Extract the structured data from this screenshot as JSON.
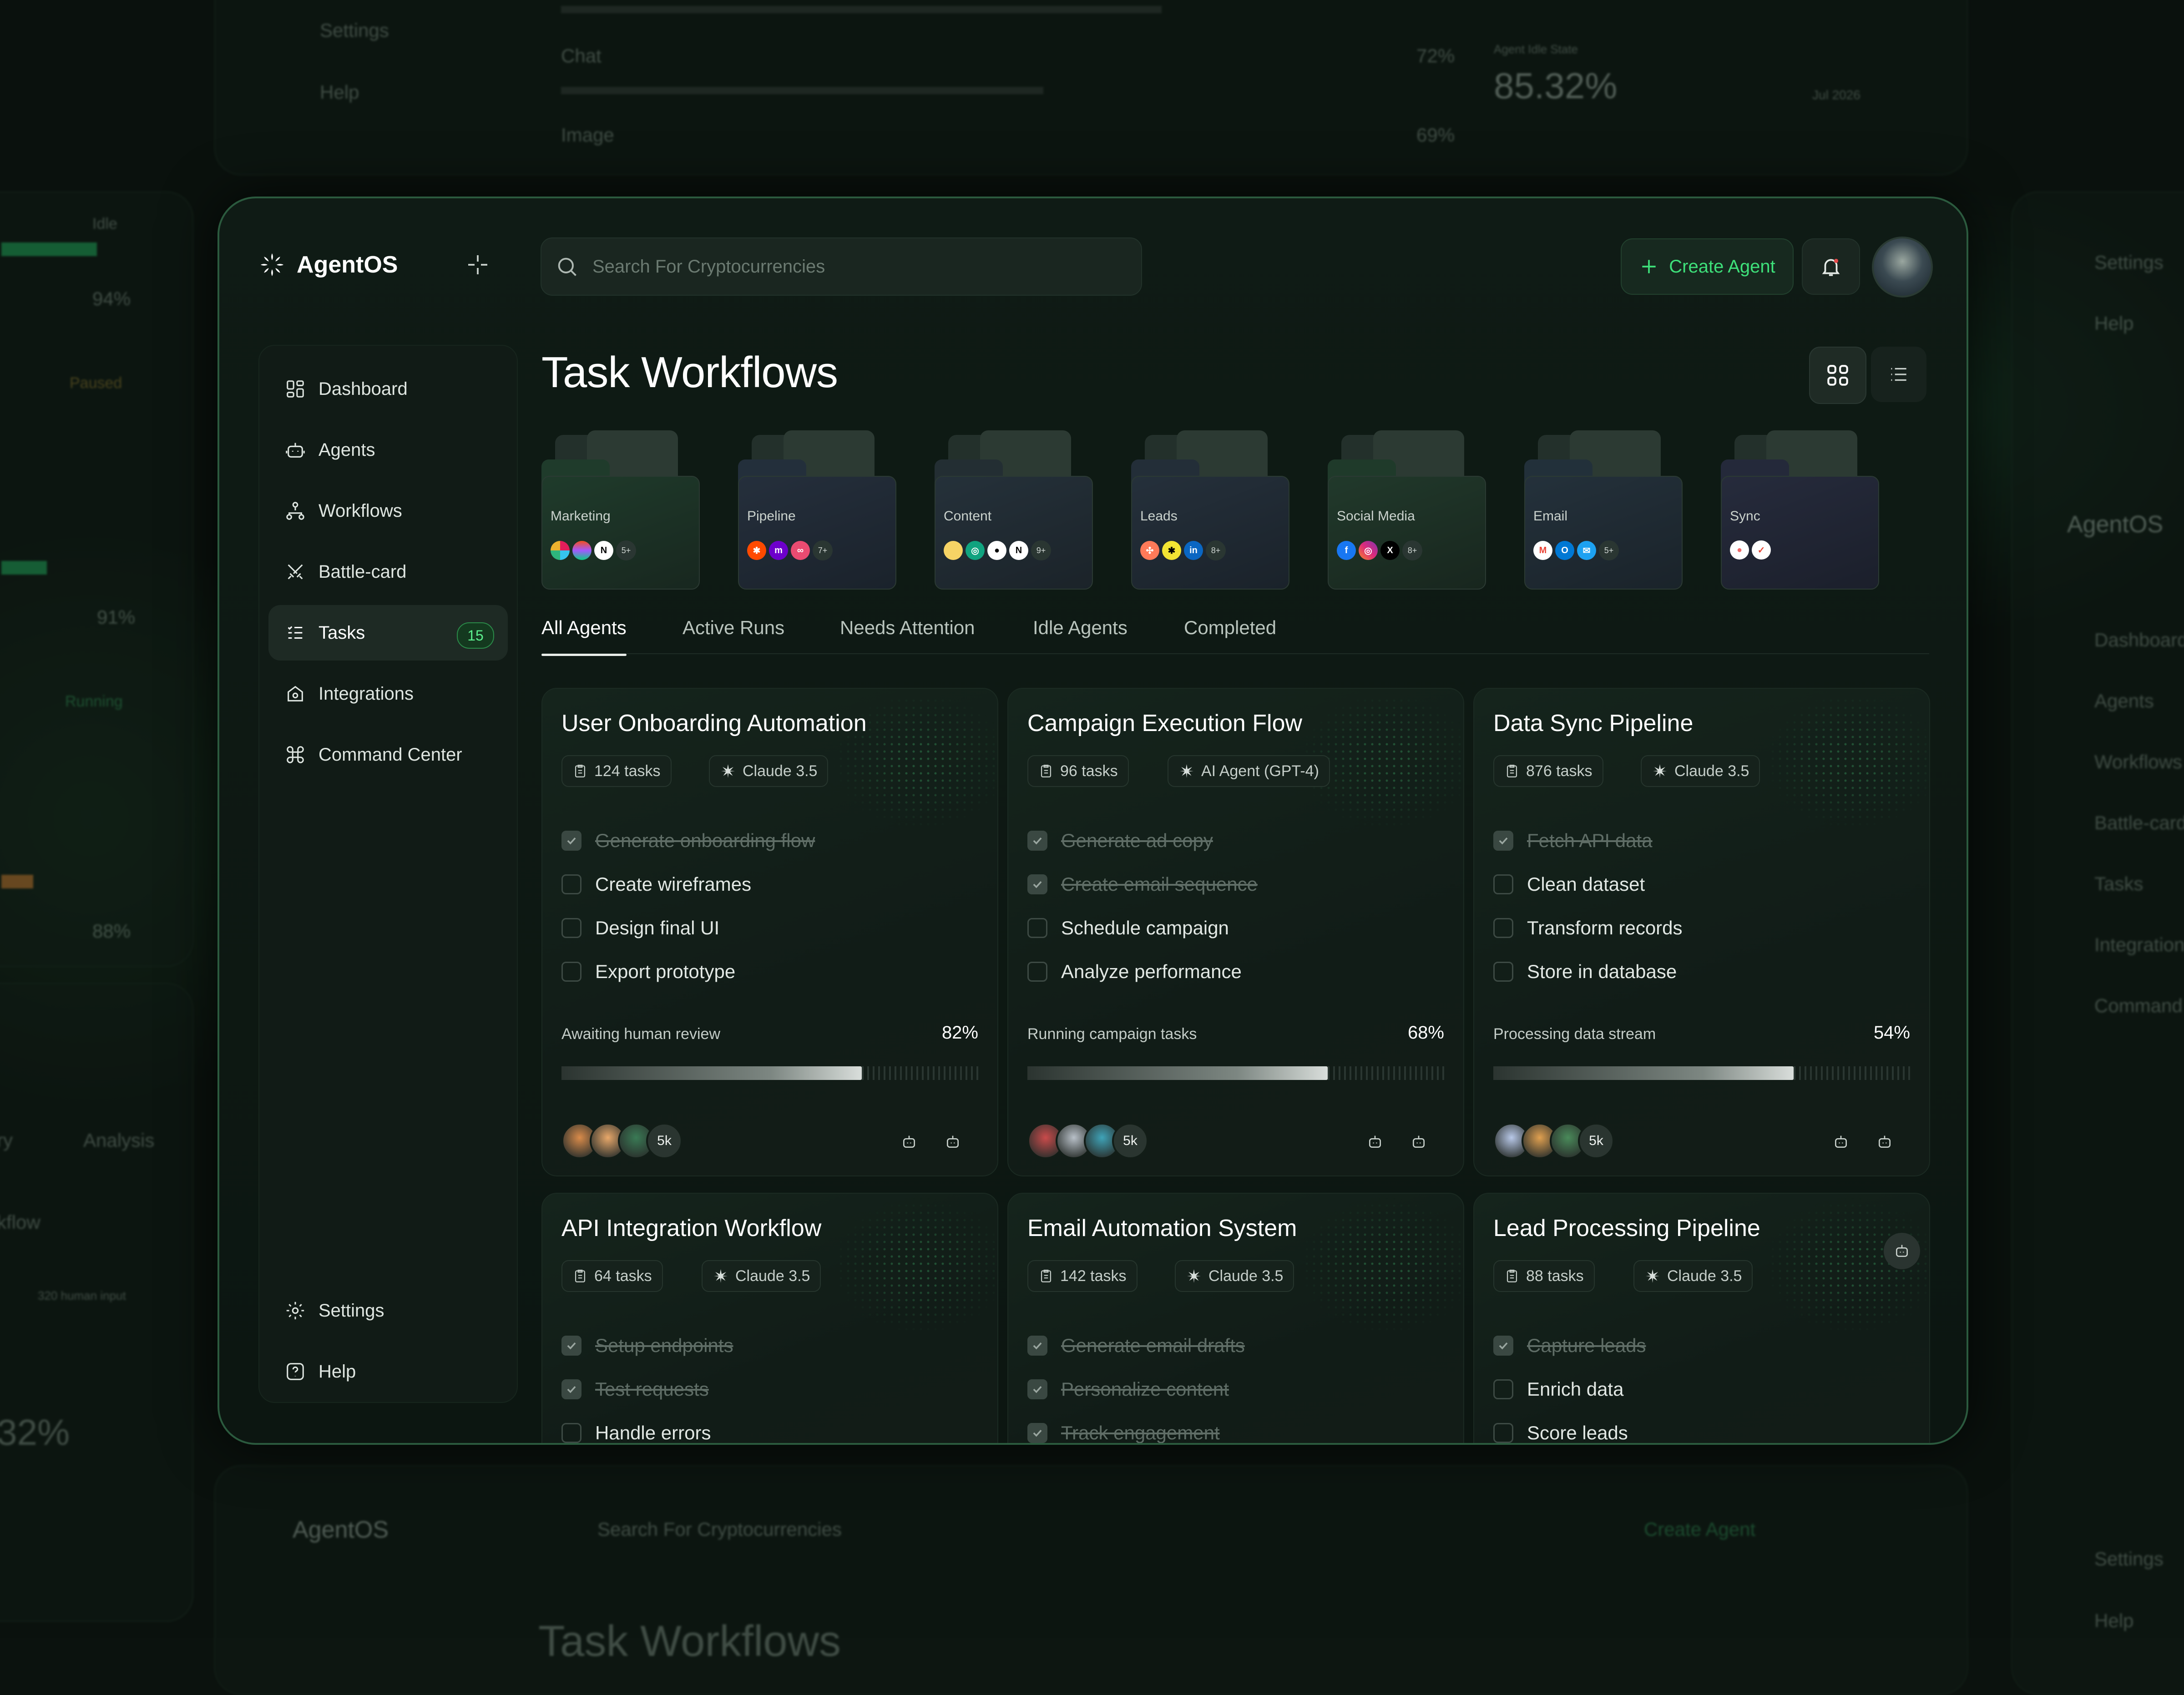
{
  "app": {
    "name": "AgentOS"
  },
  "search": {
    "placeholder": "Search For Cryptocurrencies"
  },
  "header": {
    "create_label": "Create Agent"
  },
  "sidebar": {
    "items": [
      {
        "label": "Dashboard",
        "icon": "dashboard-icon"
      },
      {
        "label": "Agents",
        "icon": "robot-icon"
      },
      {
        "label": "Workflows",
        "icon": "workflow-icon"
      },
      {
        "label": "Battle-card",
        "icon": "swords-icon"
      },
      {
        "label": "Tasks",
        "icon": "tasks-icon",
        "badge": "15",
        "active": true
      },
      {
        "label": "Integrations",
        "icon": "integrations-icon"
      },
      {
        "label": "Command Center",
        "icon": "command-icon"
      }
    ],
    "footer": [
      {
        "label": "Settings",
        "icon": "gear-icon"
      },
      {
        "label": "Help",
        "icon": "help-icon"
      }
    ]
  },
  "page": {
    "title": "Task Workflows"
  },
  "folders": [
    {
      "name": "Marketing",
      "more": "5+"
    },
    {
      "name": "Pipeline",
      "more": "7+"
    },
    {
      "name": "Content",
      "more": "9+"
    },
    {
      "name": "Leads",
      "more": "8+"
    },
    {
      "name": "Social Media",
      "more": "8+"
    },
    {
      "name": "Email",
      "more": "5+"
    },
    {
      "name": "Sync",
      "more": ""
    }
  ],
  "tabs": [
    "All Agents",
    "Active Runs",
    "Needs Attention",
    "Idle Agents",
    "Completed"
  ],
  "cards": [
    {
      "title": "User Onboarding Automation",
      "tasks": "124 tasks",
      "model": "Claude 3.5",
      "todos": [
        {
          "t": "Generate onboarding flow",
          "done": true
        },
        {
          "t": "Create wireframes",
          "done": false
        },
        {
          "t": "Design final UI",
          "done": false
        },
        {
          "t": "Export prototype",
          "done": false
        }
      ],
      "status": "Awaiting human review",
      "progress": "82%",
      "progress_value": 0.72,
      "team_more": "5k"
    },
    {
      "title": "Campaign Execution Flow",
      "tasks": "96 tasks",
      "model": "AI Agent (GPT-4)",
      "todos": [
        {
          "t": "Generate ad copy",
          "done": true
        },
        {
          "t": "Create email sequence",
          "done": true
        },
        {
          "t": "Schedule campaign",
          "done": false
        },
        {
          "t": "Analyze performance",
          "done": false
        }
      ],
      "status": "Running campaign tasks",
      "progress": "68%",
      "progress_value": 0.72,
      "team_more": "5k"
    },
    {
      "title": "Data Sync Pipeline",
      "tasks": "876 tasks",
      "model": "Claude 3.5",
      "todos": [
        {
          "t": "Fetch API data",
          "done": true
        },
        {
          "t": "Clean dataset",
          "done": false
        },
        {
          "t": "Transform records",
          "done": false
        },
        {
          "t": "Store in database",
          "done": false
        }
      ],
      "status": "Processing data stream",
      "progress": "54%",
      "progress_value": 0.72,
      "team_more": "5k"
    },
    {
      "title": "API Integration Workflow",
      "tasks": "64 tasks",
      "model": "Claude 3.5",
      "todos": [
        {
          "t": "Setup endpoints",
          "done": true
        },
        {
          "t": "Test requests",
          "done": true
        },
        {
          "t": "Handle errors",
          "done": false
        }
      ]
    },
    {
      "title": "Email Automation System",
      "tasks": "142 tasks",
      "model": "Claude 3.5",
      "todos": [
        {
          "t": "Generate email drafts",
          "done": true
        },
        {
          "t": "Personalize content",
          "done": true
        },
        {
          "t": "Track engagement",
          "done": true
        }
      ]
    },
    {
      "title": "Lead Processing Pipeline",
      "tasks": "88 tasks",
      "model": "Claude 3.5",
      "todos": [
        {
          "t": "Capture leads",
          "done": true
        },
        {
          "t": "Enrich data",
          "done": false
        },
        {
          "t": "Score leads",
          "done": false
        }
      ]
    }
  ],
  "background": {
    "top_panel": {
      "settings": "Settings",
      "help": "Help",
      "chat": "Chat",
      "chat_pct": "72%",
      "image": "Image",
      "image_pct": "69%",
      "stat_label": "Agent Idle State",
      "stat_value": "85.32%",
      "date": "Jul 2026"
    },
    "left_panel": {
      "idle": "Idle",
      "paused": "Paused",
      "running": "Running",
      "p1": "94%",
      "p2": "91%",
      "p3": "88%",
      "analysis": "Analysis",
      "workflow": "kflow",
      "ry": "ry",
      "human_input": "320 human input",
      "gauge": "32%"
    },
    "right_panel": {
      "settings": "Settings",
      "help": "Help",
      "logo": "AgentOS",
      "items": [
        "Dashboard",
        "Agents",
        "Workflows",
        "Battle-card",
        "Tasks",
        "Integrations",
        "Command C"
      ],
      "settings2": "Settings",
      "help2": "Help"
    },
    "bottom_panel": {
      "logo": "AgentOS",
      "search": "Search For Cryptocurrencies",
      "create": "Create Agent",
      "title": "Task Workflows"
    }
  }
}
